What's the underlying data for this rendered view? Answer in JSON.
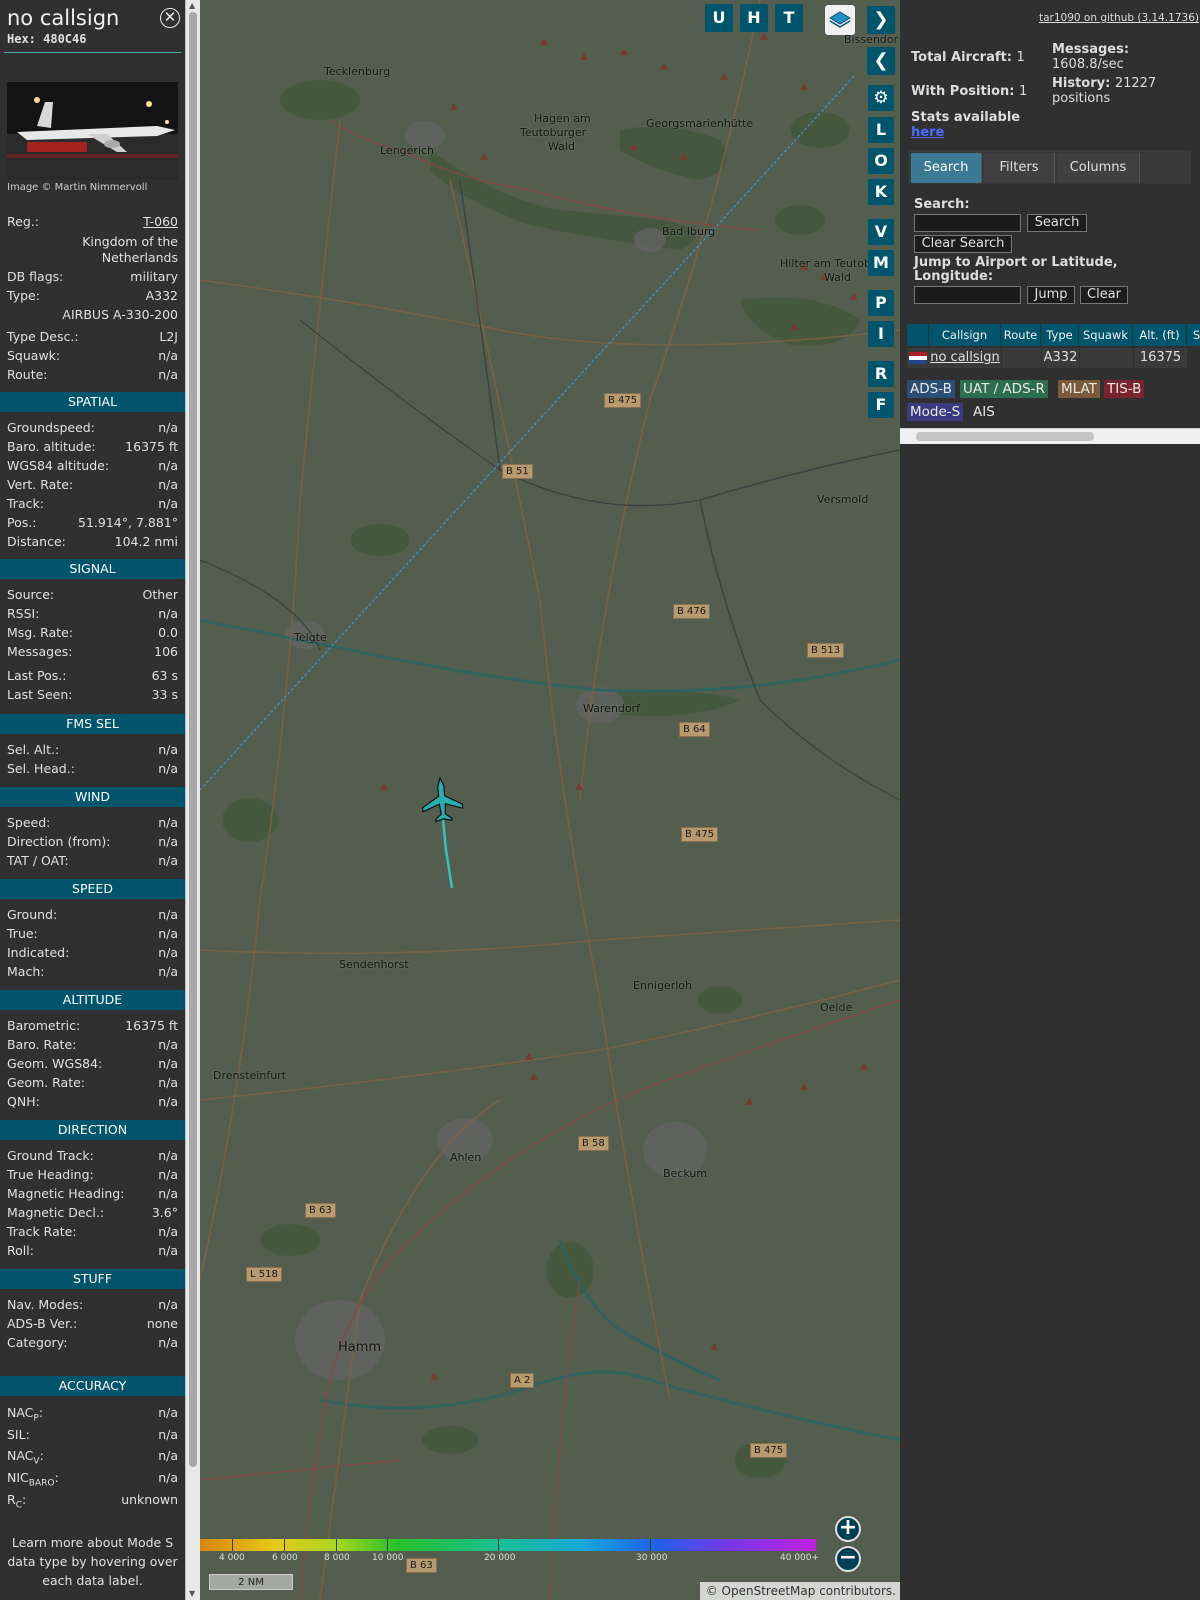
{
  "info": {
    "callsign": "no callsign",
    "hex": "Hex: 480C46",
    "photo_credit": "Image © Martin Nimmervoll",
    "fields_top": [
      {
        "k": "Reg.:",
        "v": "T-060"
      },
      {
        "k": "DB flags:",
        "v": "military"
      },
      {
        "k": "Type:",
        "v": "A332"
      },
      {
        "k": "Type Desc.:",
        "v": "L2J"
      },
      {
        "k": "Squawk:",
        "v": "n/a"
      },
      {
        "k": "Route:",
        "v": "n/a"
      }
    ],
    "country_line1": "Kingdom of the",
    "country_line2": "Netherlands",
    "type_full": "AIRBUS A-330-200",
    "sections": [
      {
        "title": "SPATIAL",
        "rows": [
          {
            "k": "Groundspeed:",
            "v": "n/a"
          },
          {
            "k": "Baro. altitude:",
            "v": "16375 ft"
          },
          {
            "k": "WGS84 altitude:",
            "v": "n/a"
          },
          {
            "k": "Vert. Rate:",
            "v": "n/a"
          },
          {
            "k": "Track:",
            "v": "n/a"
          },
          {
            "k": "Pos.:",
            "v": "51.914°, 7.881°"
          },
          {
            "k": "Distance:",
            "v": "104.2 nmi"
          }
        ]
      },
      {
        "title": "SIGNAL",
        "rows": [
          {
            "k": "Source:",
            "v": "Other"
          },
          {
            "k": "RSSI:",
            "v": "n/a"
          },
          {
            "k": "Msg. Rate:",
            "v": "0.0"
          },
          {
            "k": "Messages:",
            "v": "106"
          },
          {
            "k": "Last Pos.:",
            "v": "63 s"
          },
          {
            "k": "Last Seen:",
            "v": "33 s"
          }
        ]
      },
      {
        "title": "FMS SEL",
        "rows": [
          {
            "k": "Sel. Alt.:",
            "v": "n/a"
          },
          {
            "k": "Sel. Head.:",
            "v": "n/a"
          }
        ]
      },
      {
        "title": "WIND",
        "rows": [
          {
            "k": "Speed:",
            "v": "n/a"
          },
          {
            "k": "Direction (from):",
            "v": "n/a"
          },
          {
            "k": "TAT / OAT:",
            "v": "n/a"
          }
        ]
      },
      {
        "title": "SPEED",
        "rows": [
          {
            "k": "Ground:",
            "v": "n/a"
          },
          {
            "k": "True:",
            "v": "n/a"
          },
          {
            "k": "Indicated:",
            "v": "n/a"
          },
          {
            "k": "Mach:",
            "v": "n/a"
          }
        ]
      },
      {
        "title": "ALTITUDE",
        "rows": [
          {
            "k": "Barometric:",
            "v": "16375 ft"
          },
          {
            "k": "Baro. Rate:",
            "v": "n/a"
          },
          {
            "k": "Geom. WGS84:",
            "v": "n/a"
          },
          {
            "k": "Geom. Rate:",
            "v": "n/a"
          },
          {
            "k": "QNH:",
            "v": "n/a"
          }
        ]
      },
      {
        "title": "DIRECTION",
        "rows": [
          {
            "k": "Ground Track:",
            "v": "n/a"
          },
          {
            "k": "True Heading:",
            "v": "n/a"
          },
          {
            "k": "Magnetic Heading:",
            "v": "n/a"
          },
          {
            "k": "Magnetic Decl.:",
            "v": "3.6°"
          },
          {
            "k": "Track Rate:",
            "v": "n/a"
          },
          {
            "k": "Roll:",
            "v": "n/a"
          }
        ]
      },
      {
        "title": "STUFF",
        "rows": [
          {
            "k": "Nav. Modes:",
            "v": "n/a"
          },
          {
            "k": "ADS-B Ver.:",
            "v": "none"
          },
          {
            "k": "Category:",
            "v": "n/a"
          }
        ]
      },
      {
        "title": "ACCURACY",
        "rows": []
      }
    ],
    "accuracy": {
      "nacp_base": "NAC",
      "nacp_sub": "P",
      "nacp_v": "n/a",
      "sil_k": "SIL:",
      "sil_v": "n/a",
      "nacv_base": "NAC",
      "nacv_sub": "V",
      "nacv_v": "n/a",
      "nicbaro_base": "NIC",
      "nicbaro_sub": "BARO",
      "nicbaro_v": "n/a",
      "rc_base": "R",
      "rc_sub": "C",
      "rc_v": "unknown"
    },
    "footer": "Learn more about Mode S data type by hovering over each data label."
  },
  "map": {
    "buttons_top": [
      "U",
      "H",
      "T"
    ],
    "buttons_side": [
      "L",
      "O",
      "K",
      "V",
      "M",
      "P",
      "I",
      "R",
      "F"
    ],
    "towns": [
      "Tecklenburg",
      "Hagen am",
      "Teutoburger",
      "Wald",
      "Georgsmarienhütte",
      "Lengerich",
      "Bad Iburg",
      "Hilter am Teutob",
      "Wald",
      "Versmold",
      "Telgte",
      "Warendorf",
      "Sendenhorst",
      "Ennigerloh",
      "Oelde",
      "Drensteinfurt",
      "Ahlen",
      "Beckum",
      "Hamm",
      "Bissendor"
    ],
    "roads": [
      "B 475",
      "B 51",
      "B 476",
      "B 513",
      "B 64",
      "B 475",
      "B 58",
      "B 63",
      "L 518",
      "A 2",
      "B 475",
      "B 63"
    ],
    "colorbar_labels": [
      "4 000",
      "6 000",
      "8 000",
      "10 000",
      "20 000",
      "30 000",
      "40 000+"
    ],
    "scale": "2 NM",
    "attribution_pre": "© ",
    "attribution_link": "OpenStreetMap",
    "attribution_post": " contributors."
  },
  "sidebar": {
    "github": "tar1090 on github (3.14.1736)",
    "total_label": "Total Aircraft:",
    "total_value": "1",
    "withpos_label": "With Position:",
    "withpos_value": "1",
    "stats_label": "Stats available",
    "stats_link": "here",
    "messages_label": "Messages:",
    "messages_value": "1608.8/sec",
    "history_label": "History:",
    "history_value": "21227",
    "history_unit": "positions",
    "tabs": [
      "Search",
      "Filters",
      "Columns"
    ],
    "search_label": "Search:",
    "search_button": "Search",
    "clear_search_button": "Clear Search",
    "jump_label_1": "Jump to Airport or Latitude,",
    "jump_label_2": "Longitude:",
    "jump_button": "Jump",
    "clear_button": "Clear",
    "table": {
      "headers": [
        "",
        "Callsign",
        "Route",
        "Type",
        "Squawk",
        "Alt. (ft)",
        "S"
      ],
      "row": {
        "callsign": "no callsign",
        "route": "",
        "type": "A332",
        "squawk": "",
        "alt": "16375"
      }
    },
    "legend": [
      "ADS-B",
      "UAT / ADS-R",
      "MLAT",
      "TIS-B",
      "Mode-S",
      "AIS"
    ]
  }
}
